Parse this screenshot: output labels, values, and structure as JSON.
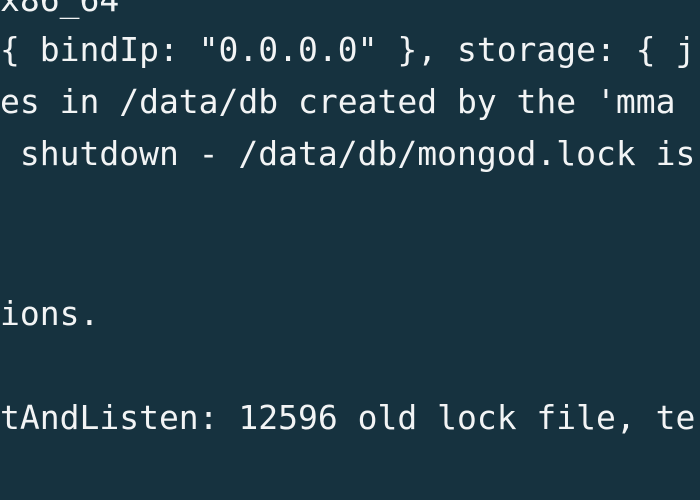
{
  "terminal": {
    "background": "#16323f",
    "foreground": "#f2f4f5",
    "lines": [
      {
        "text": "x86_64"
      },
      {
        "text": "{ bindIp: \"0.0.0.0\" }, storage: { j"
      },
      {
        "text": "es in /data/db created by the 'mma"
      },
      {
        "text": " shutdown - /data/db/mongod.lock is"
      },
      {
        "text": ""
      },
      {
        "text": ""
      },
      {
        "text": "ions."
      },
      {
        "text": ""
      },
      {
        "text": "tAndListen: 12596 old lock file, te"
      },
      {
        "text": ""
      }
    ]
  }
}
